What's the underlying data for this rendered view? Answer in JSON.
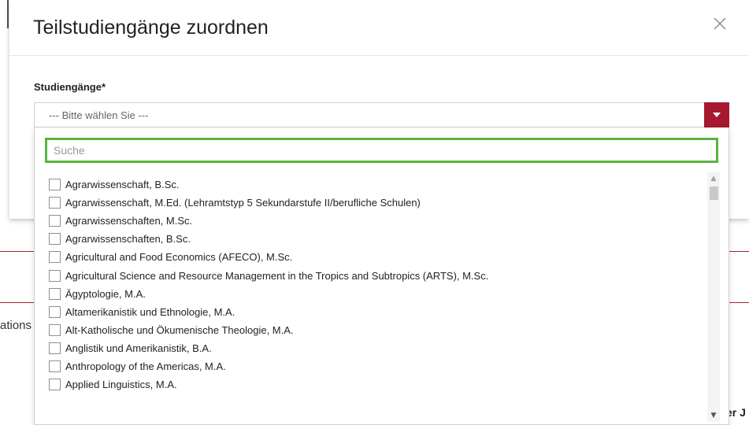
{
  "background": {
    "fragment_left": "ations",
    "fragment_bottom_right": "er J",
    "accent_color": "#a6262c"
  },
  "modal": {
    "title": "Teilstudiengänge zuordnen",
    "close_icon": "close-icon",
    "field_label": "Studiengänge*",
    "select": {
      "value": "--- Bitte wählen Sie ---",
      "caret_icon": "caret-down-icon",
      "caret_color": "#a6192e"
    },
    "dropdown": {
      "search_placeholder": "Suche",
      "search_border_color": "#5ab33e",
      "options": [
        "Agrarwissenschaft, B.Sc.",
        "Agrarwissenschaft, M.Ed. (Lehramtstyp 5 Sekundarstufe II/berufliche Schulen)",
        "Agrarwissenschaften, M.Sc.",
        "Agrarwissenschaften, B.Sc.",
        "Agricultural and Food Economics (AFECO), M.Sc.",
        "Agricultural Science and Resource Management in the Tropics and Subtropics (ARTS), M.Sc.",
        "Ägyptologie, M.A.",
        "Altamerikanistik und Ethnologie, M.A.",
        "Alt-Katholische und Ökumenische Theologie, M.A.",
        "Anglistik und Amerikanistik, B.A.",
        "Anthropology of the Americas, M.A.",
        "Applied Linguistics, M.A."
      ]
    }
  }
}
